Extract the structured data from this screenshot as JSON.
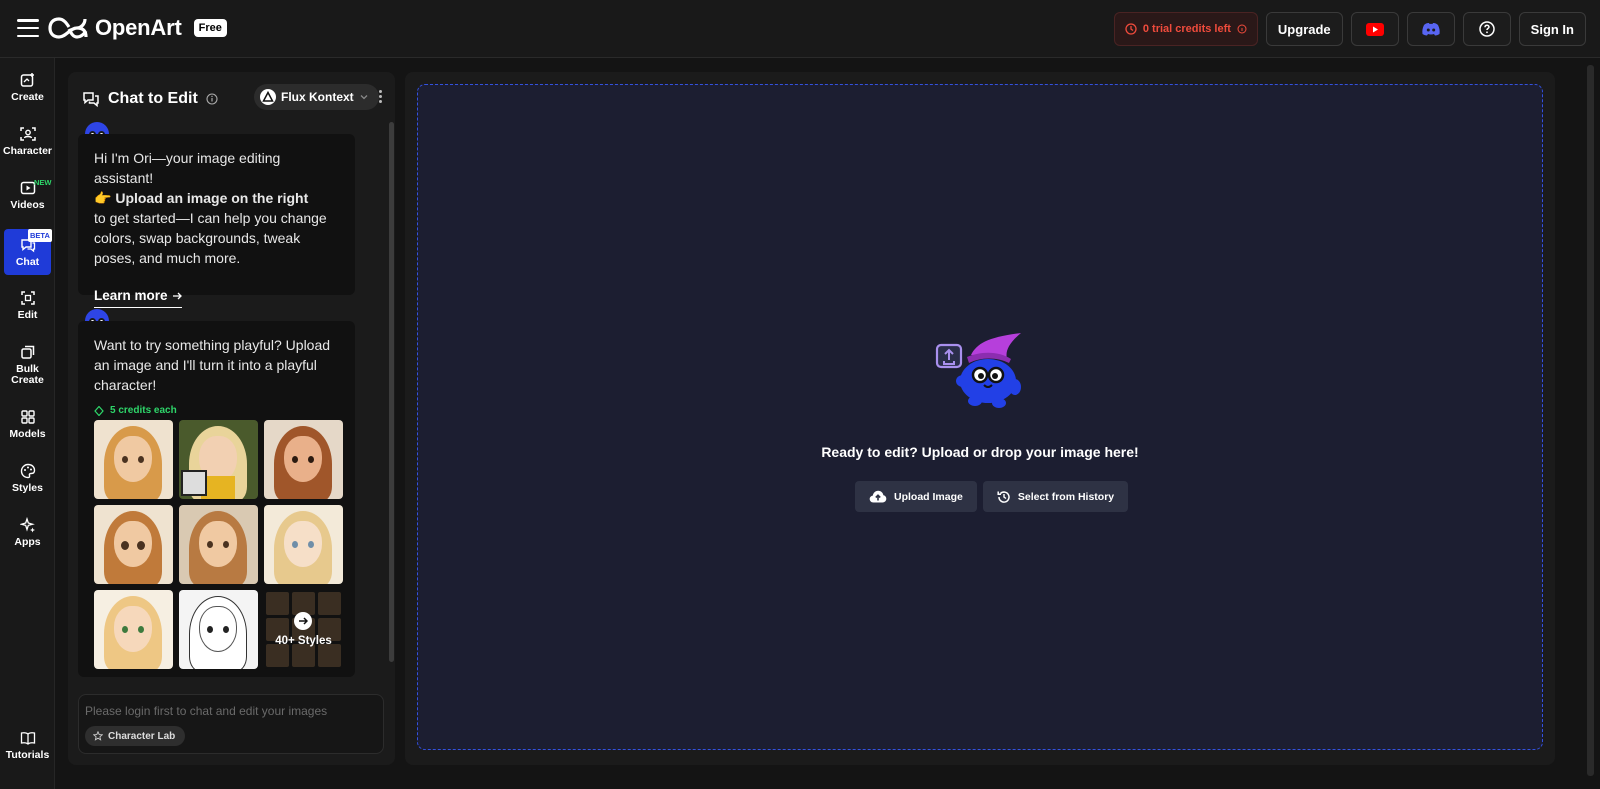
{
  "header": {
    "logo_text": "OpenArt",
    "plan_badge": "Free",
    "credits_text": "0 trial credits left",
    "upgrade_label": "Upgrade",
    "sign_in_label": "Sign In",
    "icons": [
      "menu-icon",
      "youtube-icon",
      "discord-icon",
      "help-icon"
    ]
  },
  "sidebar": {
    "items": [
      {
        "label": "Create",
        "icon": "create-icon"
      },
      {
        "label": "Character",
        "icon": "character-icon"
      },
      {
        "label": "Videos",
        "icon": "video-icon",
        "badge": "NEW"
      },
      {
        "label": "Chat",
        "icon": "chat-icon",
        "badge": "BETA",
        "active": true
      },
      {
        "label": "Edit",
        "icon": "edit-icon"
      },
      {
        "label": "Bulk",
        "label2": "Create",
        "icon": "bulk-create-icon"
      },
      {
        "label": "Models",
        "icon": "models-icon"
      },
      {
        "label": "Styles",
        "icon": "styles-icon"
      },
      {
        "label": "Apps",
        "icon": "apps-icon"
      },
      {
        "label": "Tutorials",
        "icon": "tutorials-icon"
      }
    ]
  },
  "chat": {
    "title": "Chat to Edit",
    "model_name": "Flux Kontext",
    "message1": {
      "line1": "Hi I'm Ori—your image editing assistant!",
      "emoji": "👉",
      "bold": "Upload an image on the right",
      "rest": "to get started—I can help you change colors, swap backgrounds, tweak poses, and much more.",
      "link": "Learn more"
    },
    "message2": {
      "text": "Want to try something playful? Upload an image and I'll turn it into a playful character!",
      "credits": "5 credits each",
      "more_styles": "40+ Styles"
    },
    "input_placeholder": "Please login first to chat and edit your images",
    "chip_label": "Character Lab"
  },
  "canvas": {
    "prompt": "Ready to edit? Upload or drop your image here!",
    "upload_label": "Upload Image",
    "history_label": "Select from History"
  },
  "colors": {
    "accent": "#1f3bd8",
    "dropzone_border": "#3351e0",
    "credits_red": "#ef4b3c",
    "credits_green": "#2ed66a"
  }
}
